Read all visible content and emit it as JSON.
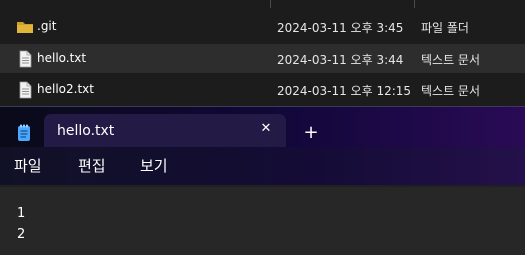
{
  "explorer": {
    "files": [
      {
        "name": ".git",
        "date": "2024-03-11 오후 3:45",
        "type": "파일 폴더",
        "icon": "folder-icon"
      },
      {
        "name": "hello.txt",
        "date": "2024-03-11 오후 3:44",
        "type": "텍스트 문서",
        "icon": "text-file-icon"
      },
      {
        "name": "hello2.txt",
        "date": "2024-03-11 오후 12:15",
        "type": "텍스트 문서",
        "icon": "text-file-icon"
      }
    ]
  },
  "notepad": {
    "app_icon": "notepad-icon",
    "tab": {
      "title": "hello.txt",
      "close_glyph": "✕"
    },
    "new_tab_glyph": "+",
    "menu": {
      "file": "파일",
      "edit": "편집",
      "view": "보기"
    },
    "content": {
      "lines": [
        "1",
        "2"
      ]
    }
  },
  "colors": {
    "folder": "#c9a227",
    "accent_tab": "#241a46",
    "app_icon": "#4aa8ff"
  }
}
